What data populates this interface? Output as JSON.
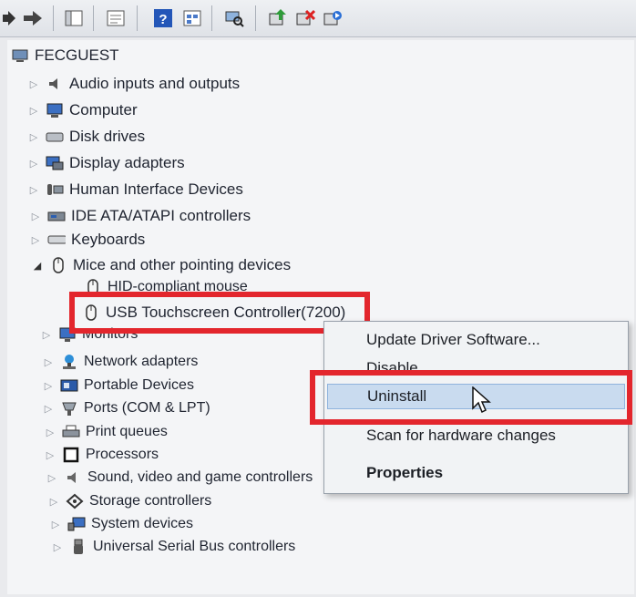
{
  "tree": {
    "root": "FECGUEST",
    "categories": [
      {
        "label": "Audio inputs and outputs",
        "icon": "speaker-icon"
      },
      {
        "label": "Computer",
        "icon": "computer-icon"
      },
      {
        "label": "Disk drives",
        "icon": "disk-drive-icon"
      },
      {
        "label": "Display adapters",
        "icon": "display-adapter-icon"
      },
      {
        "label": "Human Interface Devices",
        "icon": "hid-icon"
      },
      {
        "label": "IDE ATA/ATAPI controllers",
        "icon": "ide-controller-icon"
      },
      {
        "label": "Keyboards",
        "icon": "keyboard-icon"
      },
      {
        "label": "Mice and other pointing devices",
        "icon": "mouse-icon"
      },
      {
        "label": "Monitors",
        "icon": "monitor-icon"
      },
      {
        "label": "Network adapters",
        "icon": "network-adapter-icon"
      },
      {
        "label": "Portable Devices",
        "icon": "portable-device-icon"
      },
      {
        "label": "Ports (COM & LPT)",
        "icon": "port-icon"
      },
      {
        "label": "Print queues",
        "icon": "printer-icon"
      },
      {
        "label": "Processors",
        "icon": "processor-icon"
      },
      {
        "label": "Sound, video and game controllers",
        "icon": "sound-icon"
      },
      {
        "label": "Storage controllers",
        "icon": "storage-controller-icon"
      },
      {
        "label": "System devices",
        "icon": "system-device-icon"
      },
      {
        "label": "Universal Serial Bus controllers",
        "icon": "usb-icon"
      }
    ],
    "mice_children": [
      {
        "label": "HID-compliant mouse",
        "icon": "mouse-icon"
      },
      {
        "label": "USB Touchscreen Controller(7200)",
        "icon": "mouse-icon"
      }
    ]
  },
  "context_menu": {
    "items": [
      {
        "label": "Update Driver Software..."
      },
      {
        "label": "Disable"
      },
      {
        "label": "Uninstall"
      },
      {
        "label": "Scan for hardware changes"
      },
      {
        "label": "Properties"
      }
    ]
  },
  "colors": {
    "highlight_box": "#e3262d",
    "selection": "#c9dbef"
  }
}
